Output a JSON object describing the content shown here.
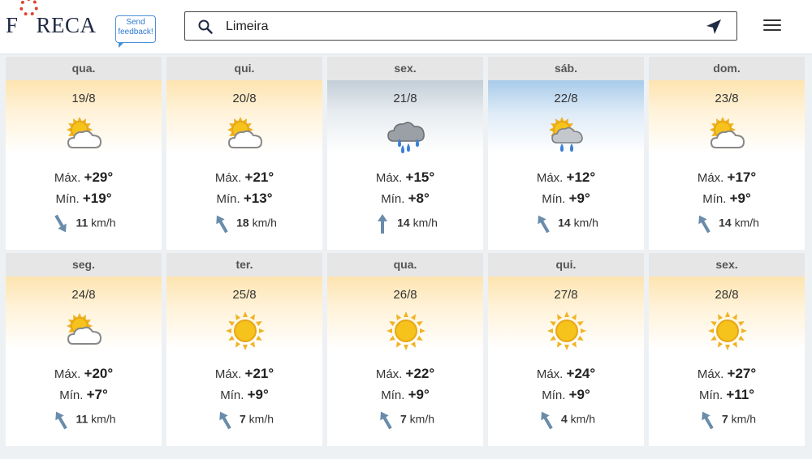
{
  "header": {
    "logo": "FORECA",
    "feedback_label": "Send feedback!",
    "search_value": "Limeira"
  },
  "colors": {
    "accent": "#4a90d9",
    "logo_ring": "#e3412f",
    "wind_arrow": "#6a8cab"
  },
  "days": [
    {
      "day": "qua.",
      "date": "19/8",
      "icon": "partly-cloudy-icon",
      "max_label": "Máx.",
      "max": "+29°",
      "min_label": "Mín.",
      "min": "+19°",
      "wind": "11",
      "wind_unit": "km/h",
      "wind_dir": "down-right"
    },
    {
      "day": "qui.",
      "date": "20/8",
      "icon": "partly-cloudy-icon",
      "max_label": "Máx.",
      "max": "+21°",
      "min_label": "Mín.",
      "min": "+13°",
      "wind": "18",
      "wind_unit": "km/h",
      "wind_dir": "up-left"
    },
    {
      "day": "sex.",
      "date": "21/8",
      "icon": "rain-cloud-icon",
      "max_label": "Máx.",
      "max": "+15°",
      "min_label": "Mín.",
      "min": "+8°",
      "wind": "14",
      "wind_unit": "km/h",
      "wind_dir": "up"
    },
    {
      "day": "sáb.",
      "date": "22/8",
      "icon": "sun-rain-icon",
      "max_label": "Máx.",
      "max": "+12°",
      "min_label": "Mín.",
      "min": "+9°",
      "wind": "14",
      "wind_unit": "km/h",
      "wind_dir": "up-left"
    },
    {
      "day": "dom.",
      "date": "23/8",
      "icon": "partly-cloudy-icon",
      "max_label": "Máx.",
      "max": "+17°",
      "min_label": "Mín.",
      "min": "+9°",
      "wind": "14",
      "wind_unit": "km/h",
      "wind_dir": "up-left"
    },
    {
      "day": "seg.",
      "date": "24/8",
      "icon": "partly-cloudy-icon",
      "max_label": "Máx.",
      "max": "+20°",
      "min_label": "Mín.",
      "min": "+7°",
      "wind": "11",
      "wind_unit": "km/h",
      "wind_dir": "up-left"
    },
    {
      "day": "ter.",
      "date": "25/8",
      "icon": "sun-icon",
      "max_label": "Máx.",
      "max": "+21°",
      "min_label": "Mín.",
      "min": "+9°",
      "wind": "7",
      "wind_unit": "km/h",
      "wind_dir": "up-left"
    },
    {
      "day": "qua.",
      "date": "26/8",
      "icon": "sun-icon",
      "max_label": "Máx.",
      "max": "+22°",
      "min_label": "Mín.",
      "min": "+9°",
      "wind": "7",
      "wind_unit": "km/h",
      "wind_dir": "up-left"
    },
    {
      "day": "qui.",
      "date": "27/8",
      "icon": "sun-icon",
      "max_label": "Máx.",
      "max": "+24°",
      "min_label": "Mín.",
      "min": "+9°",
      "wind": "4",
      "wind_unit": "km/h",
      "wind_dir": "up-left"
    },
    {
      "day": "sex.",
      "date": "28/8",
      "icon": "sun-icon",
      "max_label": "Máx.",
      "max": "+27°",
      "min_label": "Mín.",
      "min": "+11°",
      "wind": "7",
      "wind_unit": "km/h",
      "wind_dir": "up-left"
    }
  ]
}
